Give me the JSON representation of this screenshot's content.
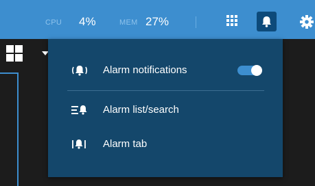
{
  "topbar": {
    "cpu_label": "CPU",
    "cpu_value": "4%",
    "mem_label": "MEM",
    "mem_value": "27%",
    "icons": [
      "grid-menu-icon",
      "bell-icon",
      "gear-icon"
    ]
  },
  "layout": {
    "icon": "quad-layout-icon"
  },
  "alarm_menu": {
    "notifications": {
      "label": "Alarm notifications",
      "icon": "ringing-bell-icon",
      "enabled": true
    },
    "list_search": {
      "label": "Alarm list/search",
      "icon": "bell-list-icon"
    },
    "tab": {
      "label": "Alarm tab",
      "icon": "bell-tab-icon"
    }
  },
  "colors": {
    "topbar": "#3d8ecf",
    "dropdown": "#14476b",
    "accent": "#3d8ecf",
    "background": "#1c1c1c"
  }
}
